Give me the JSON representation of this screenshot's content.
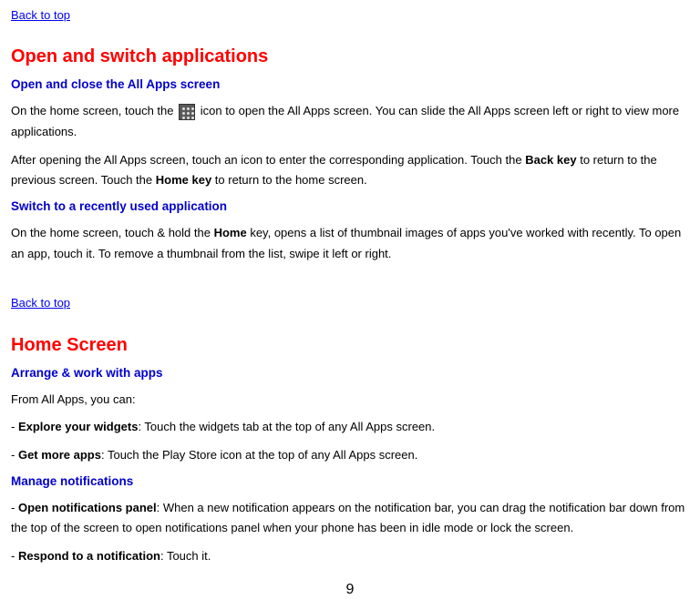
{
  "links": {
    "back_to_top": "Back to top"
  },
  "section1": {
    "title": "Open and switch applications",
    "sub1": "Open and close the All Apps screen",
    "p1a": "On the home screen, touch the ",
    "p1b": " icon to open the All Apps screen. You can slide the All Apps screen left or right to view more applications.",
    "p2a": "After opening the All Apps screen, touch an icon to enter the corresponding application. Touch the ",
    "p2_bold1": "Back key",
    "p2b": " to return to the previous screen. Touch the ",
    "p2_bold2": "Home key",
    "p2c": " to return to the home screen.",
    "sub2": "Switch to a recently used application",
    "p3a": "On the home screen, touch & hold the ",
    "p3_bold": "Home",
    "p3b": " key, opens a list of thumbnail images of apps you've worked with recently. To open an app, touch it. To remove a thumbnail from the list, swipe it left or right."
  },
  "section2": {
    "title": "Home Screen",
    "sub1": "Arrange & work with apps",
    "p1": "From All Apps, you can:",
    "li1_bold": "Explore your widgets",
    "li1_rest": ": Touch the widgets tab at the top of any All Apps screen.",
    "li2_bold": "Get more apps",
    "li2_rest": ": Touch the Play Store icon at the top of any All Apps screen.",
    "sub2": "Manage notifications",
    "li3_bold": "Open notifications panel",
    "li3_rest": ": When a new notification appears on the notification bar, you can drag the notification bar down from the top of the screen to open notifications panel when your phone has been in idle mode or lock the screen.",
    "li4_bold": "Respond to a notification",
    "li4_rest": ": Touch it."
  },
  "page_number": "9"
}
